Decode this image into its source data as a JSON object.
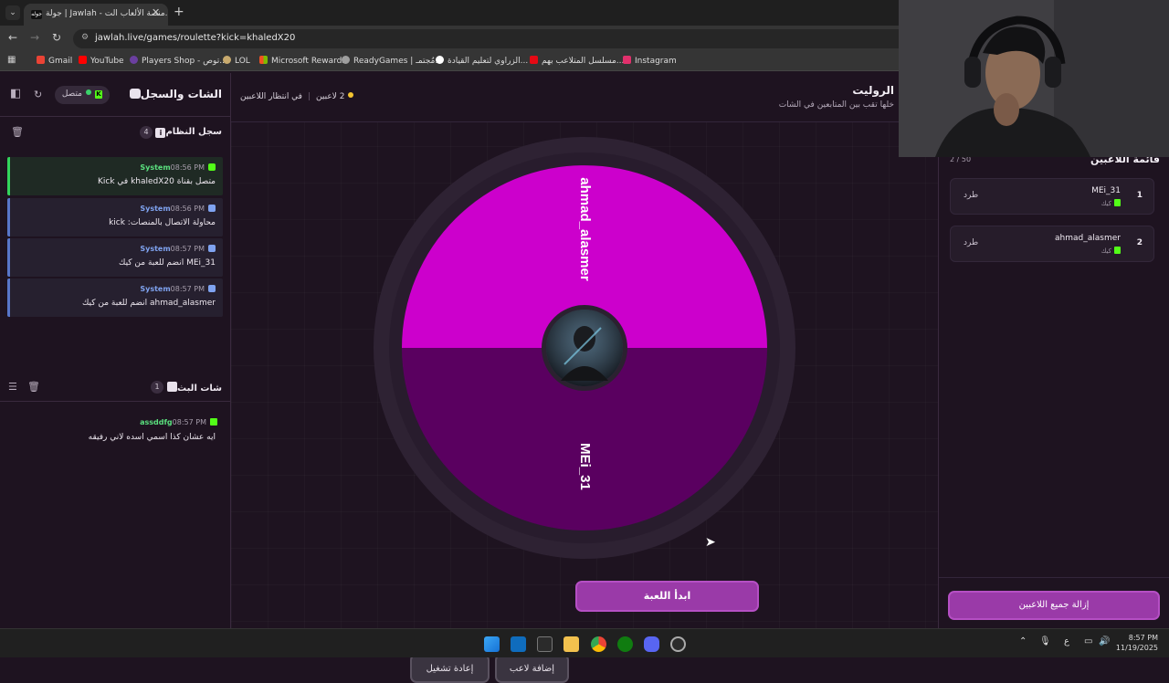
{
  "browser": {
    "tab_title": "جولة | Jawlah - منصة الألعاب الت...",
    "tab_favicon_text": "جوله",
    "url": "jawlah.live/games/roulette?kick=khaledX20",
    "bookmarks": [
      {
        "label": "Gmail",
        "color": "#ea4335"
      },
      {
        "label": "YouTube",
        "color": "#ff0000"
      },
      {
        "label": "Players Shop - توص...",
        "color": "#6b3fa0"
      },
      {
        "label": "LOL",
        "color": "#c8aa6e"
      },
      {
        "label": "Microsoft Rewards",
        "color": "#f25022"
      },
      {
        "label": "ReadyGames | مُجتمـ...",
        "color": "#9e9e9e"
      },
      {
        "label": "الزراوي لتعليم القيادة...",
        "color": "#ffffff"
      },
      {
        "label": "مسلسل المتلاعب بهم...",
        "color": "#e50914"
      },
      {
        "label": "Instagram",
        "color": "#e1306c"
      }
    ]
  },
  "chat_panel": {
    "title": "الشات والسجل",
    "status": "متصل",
    "system_log": {
      "title": "سجل النظام",
      "count": "4",
      "entries": [
        {
          "who": "System",
          "time": "08:56 PM",
          "message": "متصل بقناة khaledX20 في Kick",
          "kind": "green"
        },
        {
          "who": "System",
          "time": "08:56 PM",
          "message": "محاولة الاتصال بالمنصات: kick",
          "kind": "blue"
        },
        {
          "who": "System",
          "time": "08:57 PM",
          "message": "MEi_31 انضم للعبة من كيك",
          "kind": "blue"
        },
        {
          "who": "System",
          "time": "08:57 PM",
          "message": "ahmad_alasmer انضم للعبة من كيك",
          "kind": "blue"
        }
      ]
    },
    "stream_chat": {
      "title": "شات البث",
      "count": "1",
      "messages": [
        {
          "user": "assddfg",
          "time": "08:57 PM",
          "text": "ايه عشان كذا اسمي اسده لاني رفيقه"
        }
      ]
    }
  },
  "game": {
    "title": "الروليت",
    "subtitle": "خلها تقب بين المتابعين في الشات",
    "players_count": "2 لاعبين",
    "status": "في انتظار اللاعبين",
    "wheel": {
      "segments": [
        {
          "label": "ahmad_alasmer",
          "color": "#cc00cc"
        },
        {
          "label": "MEi_31",
          "color": "#5a0060"
        }
      ]
    },
    "buttons": {
      "start": "ابدأ اللعبة",
      "add_player": "إضافة لاعب",
      "restart": "إعادة تشغيل"
    }
  },
  "players_panel": {
    "title": "قائمة اللاعبين",
    "caption": "2 / 50",
    "players": [
      {
        "num": "1",
        "name": "MEi_31",
        "platform": "كيك",
        "action": "طرد"
      },
      {
        "num": "2",
        "name": "ahmad_alasmer",
        "platform": "كيك",
        "action": "طرد"
      }
    ],
    "remove_all": "إزالة جميع اللاعبين"
  },
  "taskbar": {
    "lang": "ع",
    "time": "8:57 PM",
    "date": "11/19/2025"
  }
}
